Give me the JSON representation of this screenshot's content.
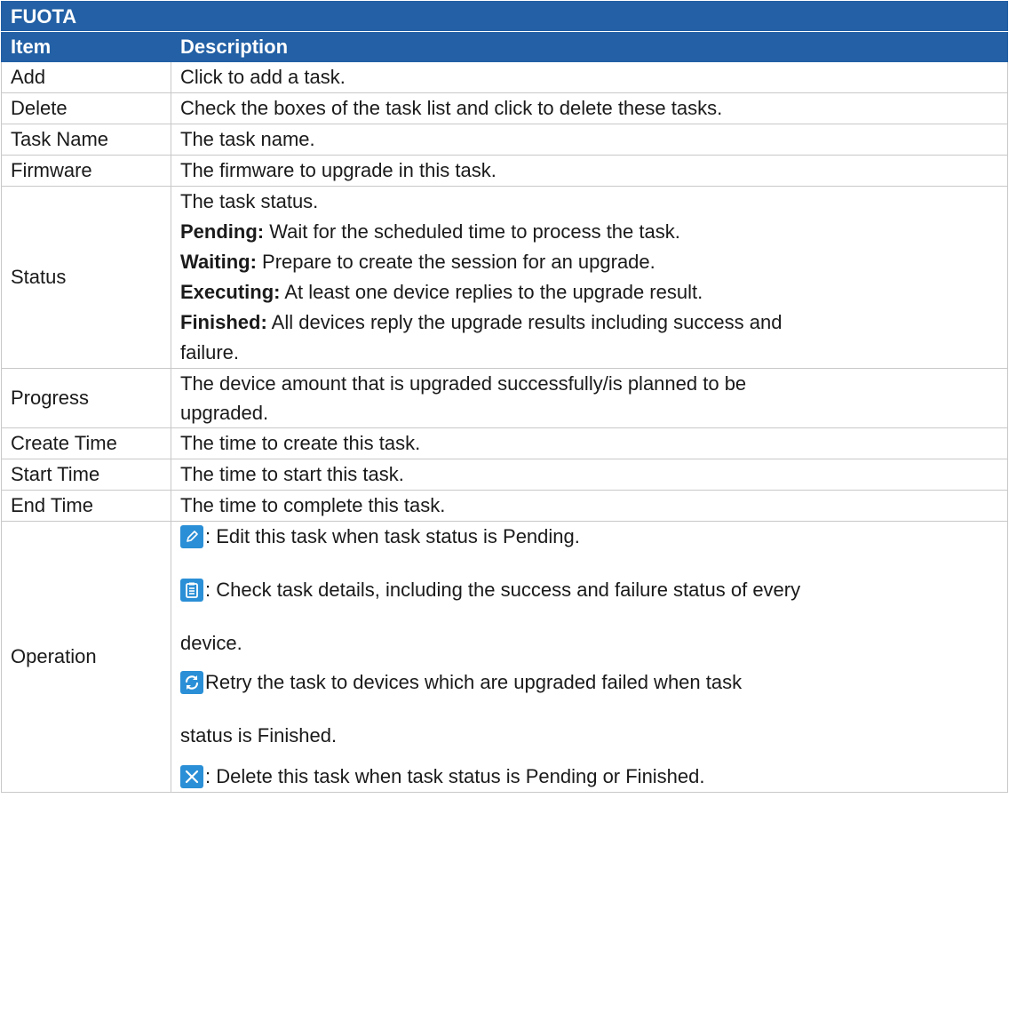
{
  "table": {
    "title": "FUOTA",
    "headers": {
      "item": "Item",
      "description": "Description"
    },
    "rows": {
      "add": {
        "item": "Add",
        "desc": "Click to add a task."
      },
      "delete": {
        "item": "Delete",
        "desc": "Check the boxes of the task list and click to delete these tasks."
      },
      "task_name": {
        "item": "Task Name",
        "desc": "The task name."
      },
      "firmware": {
        "item": "Firmware",
        "desc": "The firmware to upgrade in this task."
      },
      "status": {
        "item": "Status",
        "intro": "The task status.",
        "pending_label": "Pending:",
        "pending_text": " Wait for the scheduled time to process the task.",
        "waiting_label": "Waiting:",
        "waiting_text": " Prepare to create the session for an upgrade.",
        "executing_label": "Executing:",
        "executing_text": " At least one device replies to the upgrade result.",
        "finished_label": "Finished:",
        "finished_text_1": " All devices reply the upgrade results including success and",
        "finished_text_2": "failure."
      },
      "progress": {
        "item": "Progress",
        "desc_1": "The device amount that is upgraded successfully/is planned to be",
        "desc_2": "upgraded."
      },
      "create_time": {
        "item": "Create Time",
        "desc": "The time to create this task."
      },
      "start_time": {
        "item": "Start Time",
        "desc": "The time to start this task."
      },
      "end_time": {
        "item": "End Time",
        "desc": "The time to complete this task."
      },
      "operation": {
        "item": "Operation",
        "edit_text": ": Edit this task when task status is Pending.",
        "details_text_1": " : Check task details, including the success and failure status of every",
        "details_text_2": "device.",
        "retry_text_1": "  Retry the task to devices which are upgraded failed when task",
        "retry_text_2": "status is Finished.",
        "delete_text": ": Delete this task when task status is Pending or Finished."
      }
    }
  },
  "icons": {
    "edit": "pencil-icon",
    "details": "clipboard-icon",
    "retry": "refresh-icon",
    "delete": "close-icon"
  },
  "colors": {
    "header_bg": "#2360a5",
    "icon_bg": "#2a8fd6"
  }
}
